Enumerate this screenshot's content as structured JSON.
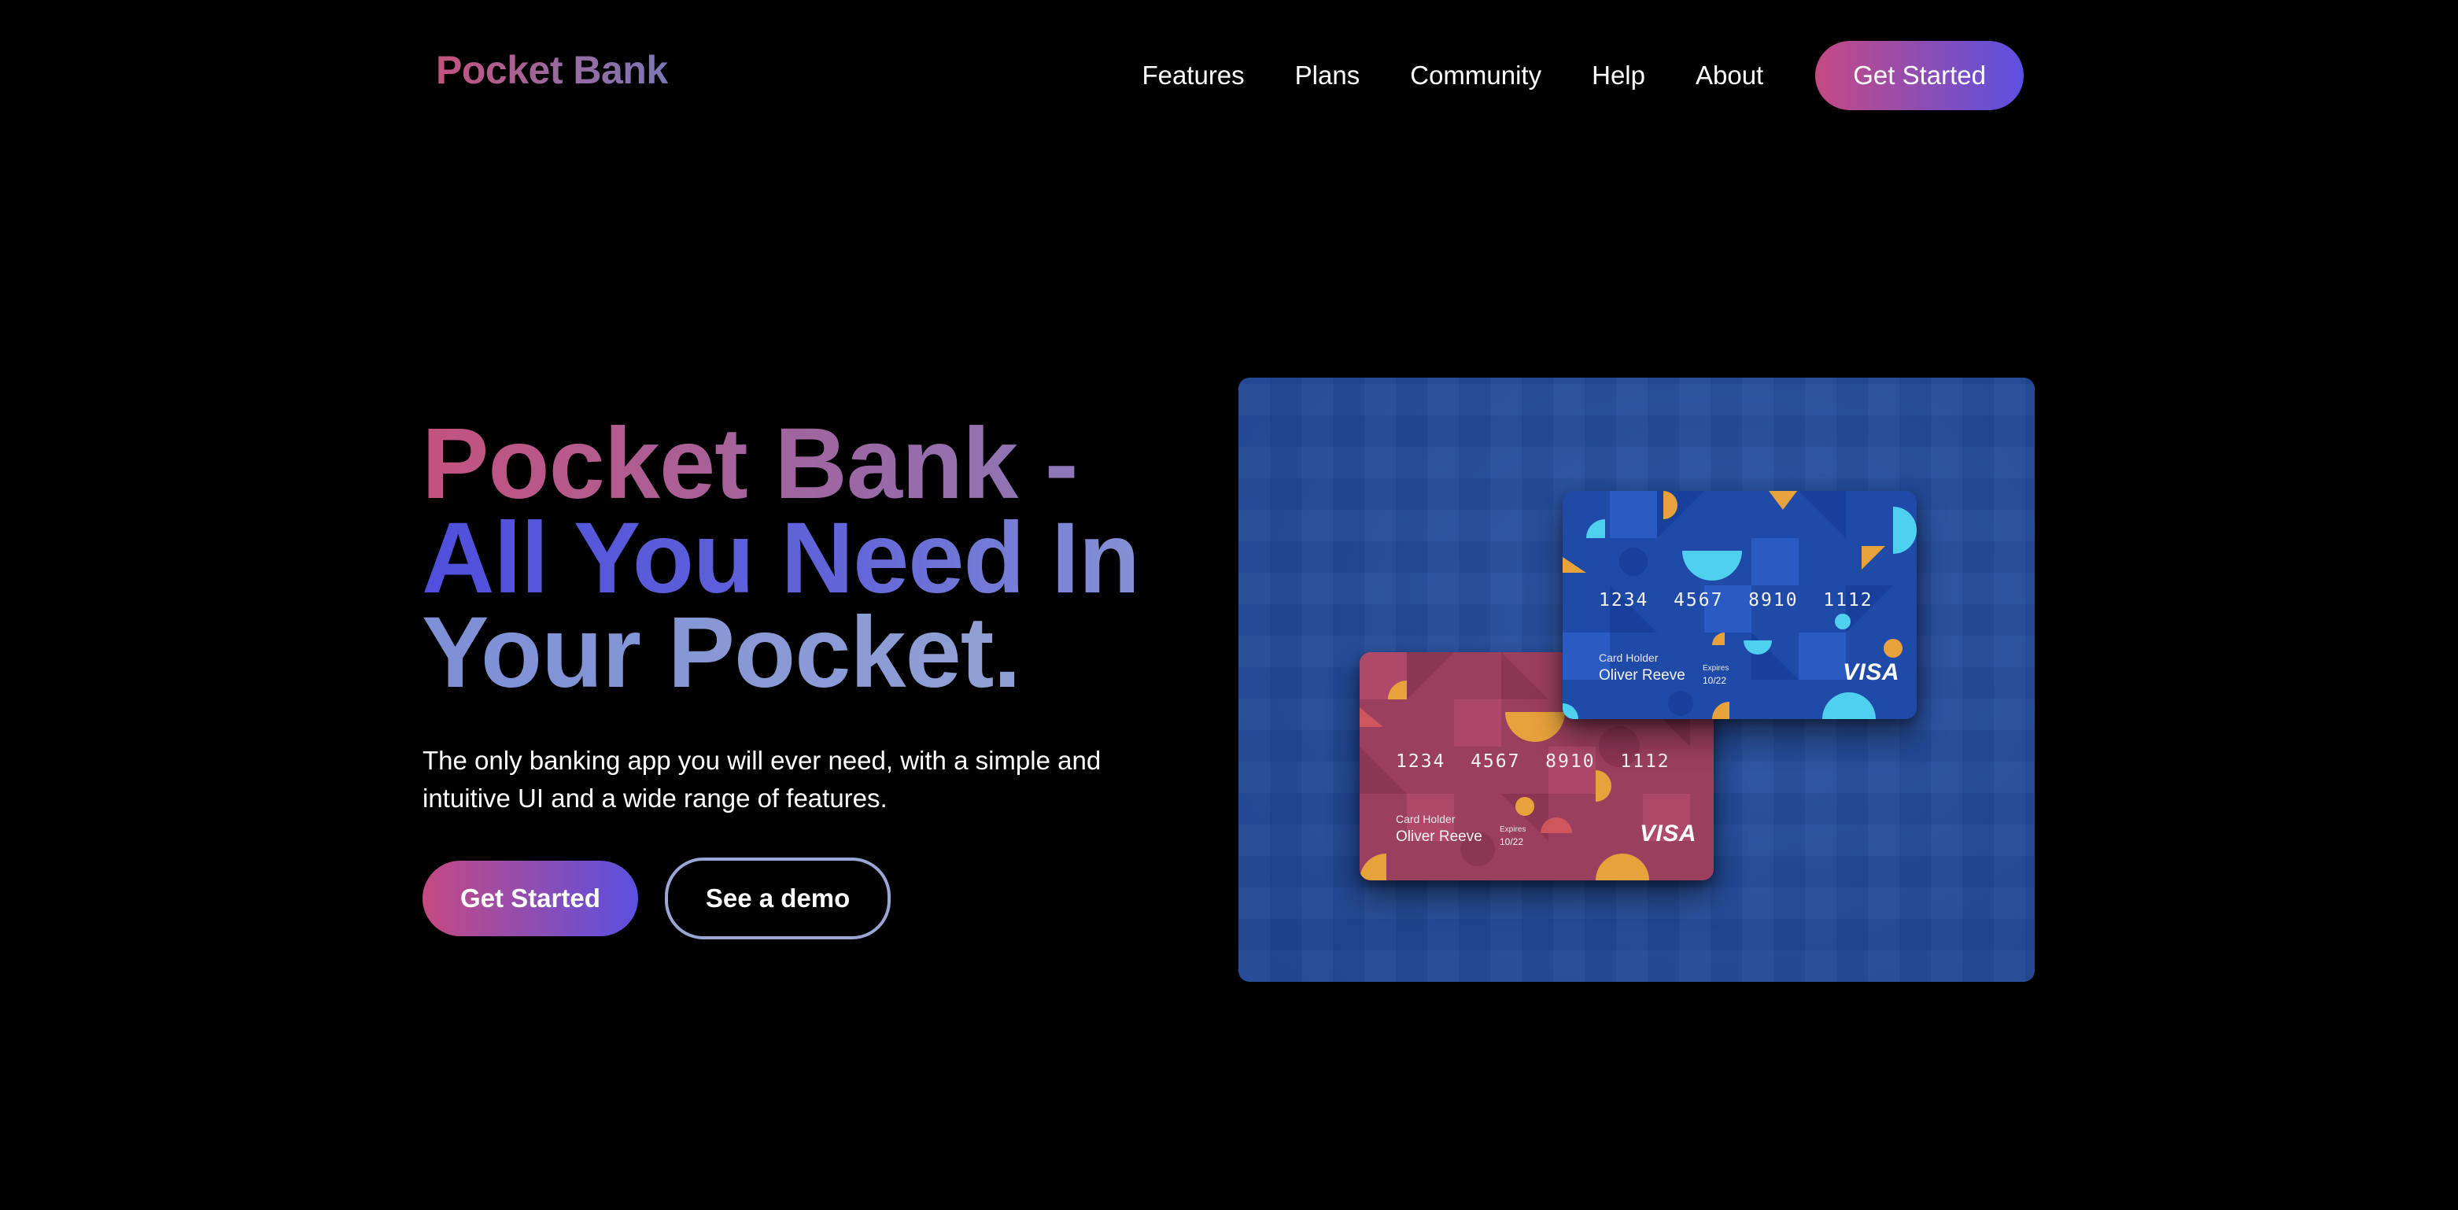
{
  "header": {
    "logo": "Pocket Bank",
    "nav": [
      {
        "label": "Features"
      },
      {
        "label": "Plans"
      },
      {
        "label": "Community"
      },
      {
        "label": "Help"
      },
      {
        "label": "About"
      }
    ],
    "cta_label": "Get Started"
  },
  "hero": {
    "title_lines": [
      "Pocket Bank -",
      "All You Need In",
      "Your Pocket."
    ],
    "subtitle": "The only banking app you will ever need, with a simple and intuitive UI and a wide range of features.",
    "primary_button": "Get Started",
    "secondary_button": "See a demo"
  },
  "cards": {
    "blue": {
      "number": "1234  4567  8910  1112",
      "holder_label": "Card Holder",
      "holder_name": "Oliver Reeve",
      "expires_label": "Expires",
      "expires_value": "10/22",
      "brand": "VISA"
    },
    "pink": {
      "number": "1234  4567  8910  1112",
      "holder_label": "Card Holder",
      "holder_name": "Oliver Reeve",
      "expires_label": "Expires",
      "expires_value": "10/22",
      "brand": "VISA"
    }
  },
  "colors": {
    "background": "#000000",
    "gradient_pink": "#c54a82",
    "gradient_violet": "#5a50e0",
    "outline_border": "#9aa6d6",
    "promo_blue": "#244c9b",
    "card_blue": "#1f4aa8",
    "card_pink": "#9b3f5e",
    "accent_orange": "#e7a23c",
    "accent_cyan": "#4fd0ef"
  },
  "icons": [
    "visa-logo"
  ]
}
